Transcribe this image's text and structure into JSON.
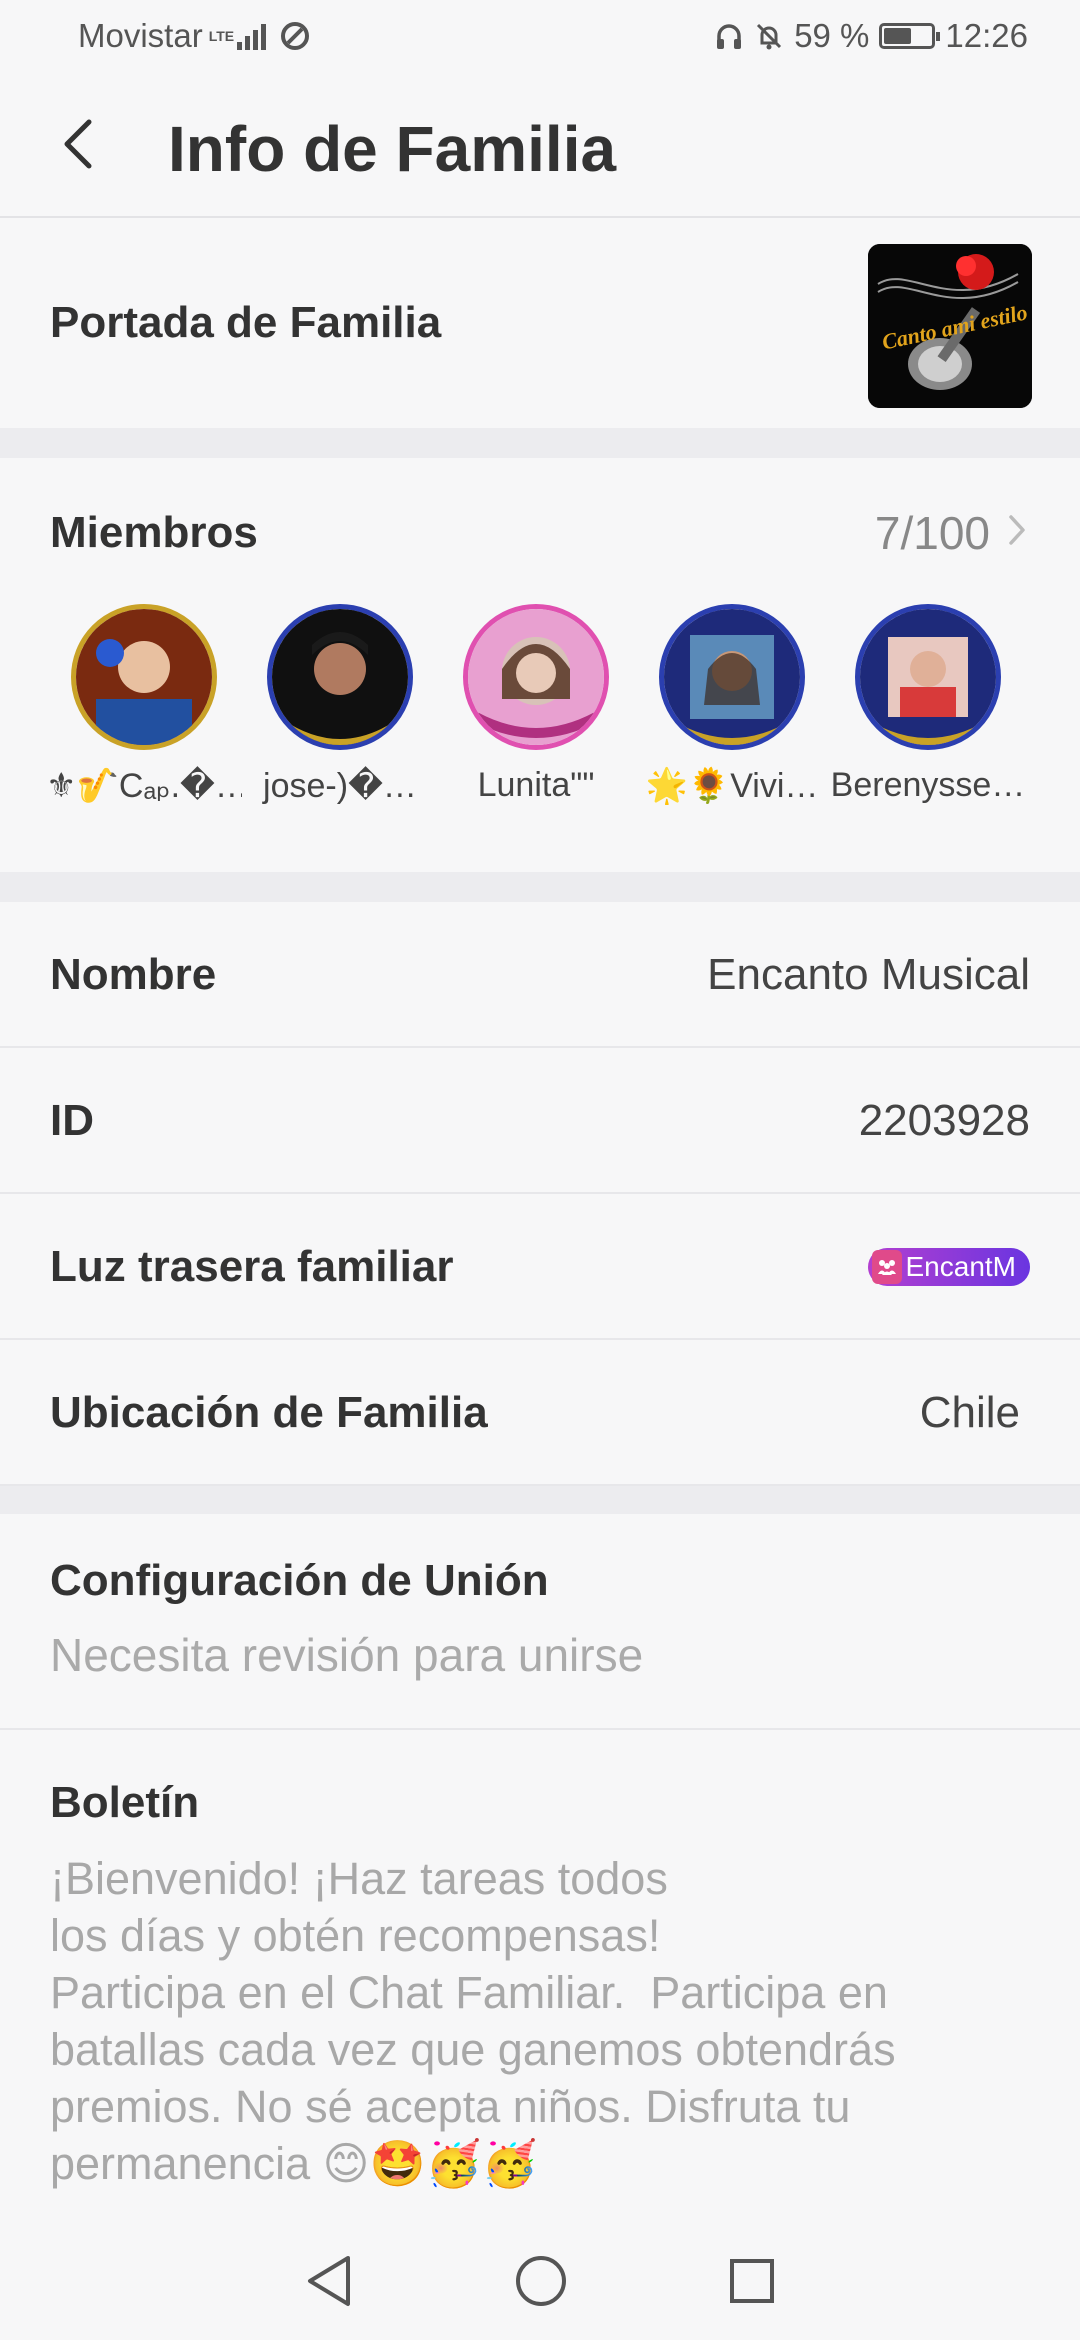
{
  "status_bar": {
    "carrier": "Movistar",
    "network": "LTE",
    "battery": "59 %",
    "battery_level": 0.59,
    "time": "12:26"
  },
  "header": {
    "title": "Info de Familia"
  },
  "cover": {
    "label": "Portada de Familia",
    "image_text": "Canto ami estilo"
  },
  "members": {
    "label": "Miembros",
    "count": "7/100",
    "list": [
      {
        "name": "⚜🎷Cₐₚ.�…",
        "ring": "#c9a227",
        "bg": "#7a2a10"
      },
      {
        "name": "jose-)�…",
        "ring": "#2b3fb0",
        "bg": "#101010"
      },
      {
        "name": "Lunita\"\"",
        "ring": "#e050b0",
        "bg": "#c9b3a8"
      },
      {
        "name": "🌟🌻Vivi…",
        "ring": "#2b3fb0",
        "bg": "#3a6a9a"
      },
      {
        "name": "Berenysse…",
        "ring": "#2b3fb0",
        "bg": "#d86060"
      }
    ]
  },
  "details": {
    "name_label": "Nombre",
    "name_value": "Encanto Musical",
    "id_label": "ID",
    "id_value": "2203928",
    "backlight_label": "Luz trasera familiar",
    "backlight_badge": "EncantM",
    "location_label": "Ubicación de Familia",
    "location_value": "Chile"
  },
  "join": {
    "label": "Configuración de Unión",
    "value": "Necesita revisión para unirse"
  },
  "bulletin": {
    "label": "Boletín",
    "text": "¡Bienvenido! ¡Haz tareas todos\nlos días y obtén recompensas!\nParticipa en el Chat Familiar.  Participa en batallas cada vez que ganemos obtendrás premios. No sé acepta niños. Disfruta tu permanencia 😊🤩🥳🥳"
  },
  "colors": {
    "background": "#f7f7f8",
    "divider": "#ececef",
    "badge_start": "#b33fd0",
    "badge_end": "#6a35e0"
  },
  "icons": [
    "back-arrow-icon",
    "chevron-right-icon",
    "nav-back-icon",
    "nav-home-icon",
    "nav-recents-icon"
  ]
}
